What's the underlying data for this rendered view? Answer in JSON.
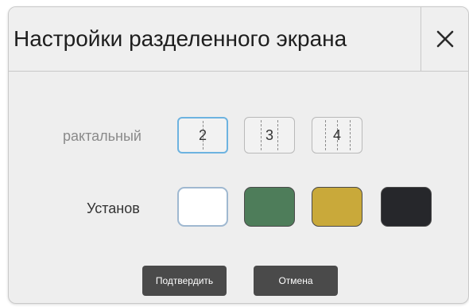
{
  "dialog": {
    "title": "Настройки разделенного экрана",
    "close_icon": "close-icon"
  },
  "split_row": {
    "label": "рактальный",
    "options": [
      {
        "label": "2",
        "selected": true
      },
      {
        "label": "3",
        "selected": false
      },
      {
        "label": "4",
        "selected": false
      }
    ]
  },
  "color_row": {
    "label": "Установ",
    "swatches": [
      {
        "color": "#ffffff",
        "selected": true
      },
      {
        "color": "#4e7d5a",
        "selected": false
      },
      {
        "color": "#c9a93a",
        "selected": false
      },
      {
        "color": "#26272b",
        "selected": false
      }
    ]
  },
  "buttons": {
    "confirm_label": "Подтвердить",
    "cancel_label": "Отмена"
  },
  "colors": {
    "dialog_bg": "#eeeeee",
    "button_bg": "#4a4a4a",
    "selected_outline": "#6db3e0"
  }
}
